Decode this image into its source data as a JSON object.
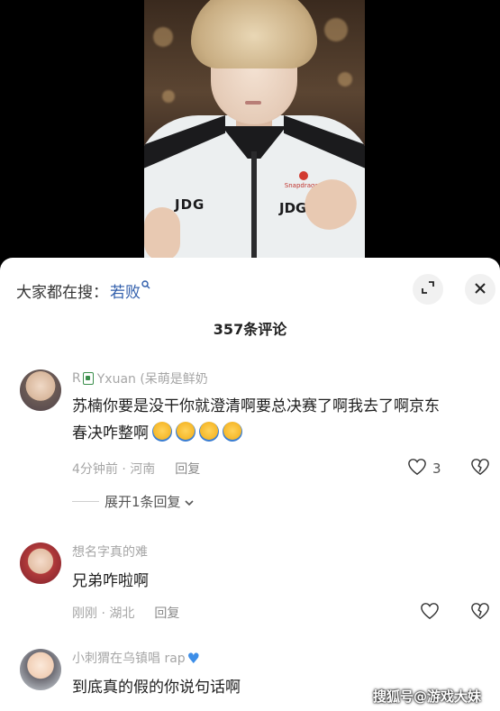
{
  "search": {
    "prefix": "大家都在搜：",
    "term": "若败"
  },
  "comments_title": "357条评论",
  "comments": [
    {
      "name_prefix": "R",
      "name_suffix": "Yxuan (呆萌是鲜奶",
      "text": "苏楠你要是没干你就澄清啊要总决赛了啊我去了啊京东春决咋整啊",
      "time_location": "4分钟前 · 河南",
      "reply_label": "回复",
      "like_count": "3",
      "expand_replies_label": "展开1条回复"
    },
    {
      "name": "想名字真的难",
      "text": "兄弟咋啦啊",
      "time_location": "刚刚 · 湖北",
      "reply_label": "回复"
    },
    {
      "name": "小刺猬在乌镇唱 rap",
      "text": "到底真的假的你说句话啊"
    }
  ],
  "watermark": "搜狐号@游戏大妹",
  "colors": {
    "link": "#2f5dab",
    "muted": "#a6a6a6",
    "sheet_bg": "#ffffff",
    "video_bg": "#000000"
  }
}
